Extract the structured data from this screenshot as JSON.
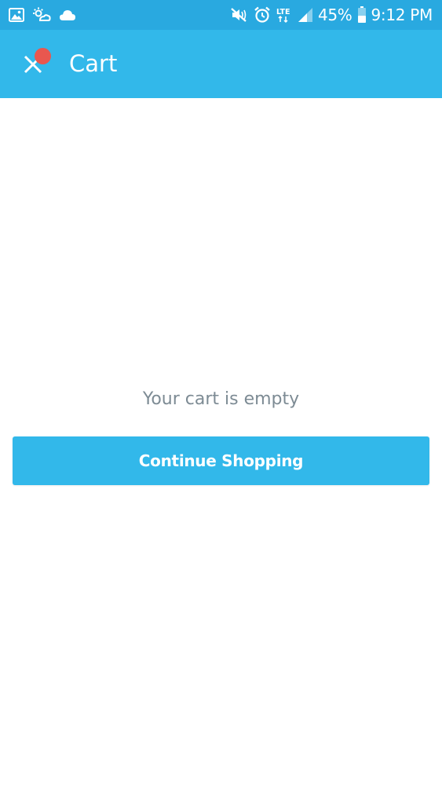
{
  "status_bar": {
    "battery_percent": "45%",
    "time": "9:12 PM",
    "network_type": "LTE",
    "left_icons": [
      "gallery-icon",
      "weather-icon",
      "cloud-icon"
    ],
    "right_icons": [
      "mute-icon",
      "alarm-icon",
      "lte-icon",
      "signal-icon",
      "battery-icon"
    ],
    "battery_level": 0.45
  },
  "app_bar": {
    "title": "Cart",
    "close_icon": "close-icon",
    "has_notification_dot": true
  },
  "cart": {
    "empty_message": "Your cart is empty",
    "continue_label": "Continue Shopping"
  },
  "colors": {
    "status_bar": "#29a9e0",
    "app_bar": "#32b8ea",
    "accent": "#32b8ea",
    "notification_dot": "#e8574f",
    "empty_text": "#7d8b94",
    "background": "#ffffff"
  }
}
